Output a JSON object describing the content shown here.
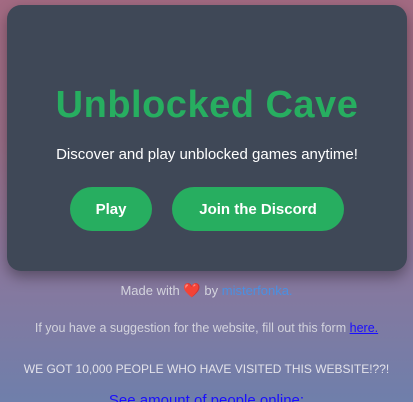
{
  "hero": {
    "title": "Unblocked Cave",
    "subtitle": "Discover and play unblocked games anytime!",
    "play_label": "Play",
    "discord_label": "Join the Discord"
  },
  "footer": {
    "made_prefix": "Made with",
    "heart_icon": "heart-icon",
    "made_by": "by",
    "author": "misterfonka.",
    "suggestion_text": "If you have a suggestion for the website, fill out this form",
    "suggestion_link": "here.",
    "visited_text": "WE GOT 10,000 PEOPLE WHO HAVE VISITED THIS WEBSITE!??!",
    "online_link": "See amount of people online:"
  },
  "colors": {
    "accent": "#27ae60",
    "card": "#3f4857",
    "link": "#4a90e2"
  }
}
